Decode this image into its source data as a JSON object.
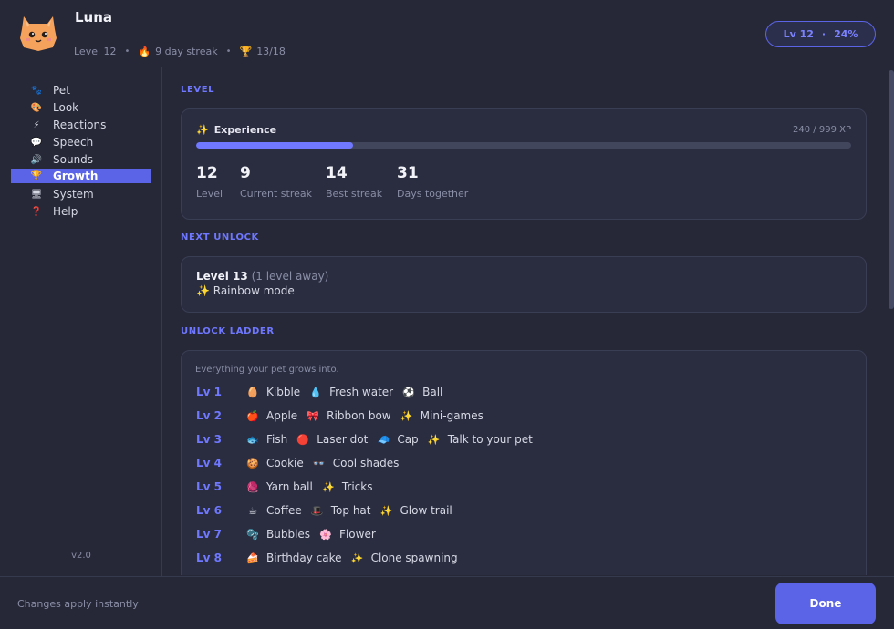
{
  "header": {
    "pet_name": "Luna",
    "level_text": "Level 12",
    "streak_icon": "🔥",
    "streak_text": "9 day streak",
    "trophy_icon": "🏆",
    "trophy_text": "13/18",
    "pill_level": "Lv 12",
    "pill_percent": "24%"
  },
  "sidebar": {
    "items": [
      {
        "icon": "🐾",
        "label": "Pet"
      },
      {
        "icon": "🎨",
        "label": "Look"
      },
      {
        "icon": "⚡",
        "label": "Reactions"
      },
      {
        "icon": "💬",
        "label": "Speech"
      },
      {
        "icon": "🔊",
        "label": "Sounds"
      },
      {
        "icon": "🏆",
        "label": "Growth"
      },
      {
        "icon": "🖥",
        "label": "System"
      },
      {
        "icon": "❓",
        "label": "Help"
      }
    ],
    "active_index": 5,
    "version": "v2.0"
  },
  "level_section": {
    "title": "LEVEL",
    "xp_icon": "✨",
    "xp_label": "Experience",
    "xp_value": "240 / 999 XP",
    "xp_fraction": 0.24,
    "stats": [
      {
        "value": "12",
        "label": "Level"
      },
      {
        "value": "9",
        "label": "Current streak"
      },
      {
        "value": "14",
        "label": "Best streak"
      },
      {
        "value": "31",
        "label": "Days together"
      }
    ]
  },
  "next_unlock": {
    "title": "NEXT UNLOCK",
    "level": "Level 13",
    "away": "(1 level away)",
    "reward": "✨ Rainbow mode"
  },
  "ladder": {
    "title": "UNLOCK LADDER",
    "caption": "Everything your pet grows into.",
    "rows": [
      {
        "lv": "Lv 1",
        "rewards": [
          {
            "icon": "🥚",
            "label": "Kibble"
          },
          {
            "icon": "💧",
            "label": "Fresh water"
          },
          {
            "icon": "⚽",
            "label": "Ball"
          }
        ]
      },
      {
        "lv": "Lv 2",
        "rewards": [
          {
            "icon": "🍎",
            "label": "Apple"
          },
          {
            "icon": "🎀",
            "label": "Ribbon bow"
          },
          {
            "icon": "✨",
            "label": "Mini-games"
          }
        ]
      },
      {
        "lv": "Lv 3",
        "rewards": [
          {
            "icon": "🐟",
            "label": "Fish"
          },
          {
            "icon": "🔴",
            "label": "Laser dot"
          },
          {
            "icon": "🧢",
            "label": "Cap"
          },
          {
            "icon": "✨",
            "label": "Talk to your pet"
          }
        ]
      },
      {
        "lv": "Lv 4",
        "rewards": [
          {
            "icon": "🍪",
            "label": "Cookie"
          },
          {
            "icon": "👓",
            "label": "Cool shades"
          }
        ]
      },
      {
        "lv": "Lv 5",
        "rewards": [
          {
            "icon": "🧶",
            "label": "Yarn ball"
          },
          {
            "icon": "✨",
            "label": "Tricks"
          }
        ]
      },
      {
        "lv": "Lv 6",
        "rewards": [
          {
            "icon": "☕",
            "label": "Coffee"
          },
          {
            "icon": "🎩",
            "label": "Top hat"
          },
          {
            "icon": "✨",
            "label": "Glow trail"
          }
        ]
      },
      {
        "lv": "Lv 7",
        "rewards": [
          {
            "icon": "🫧",
            "label": "Bubbles"
          },
          {
            "icon": "🌸",
            "label": "Flower"
          }
        ]
      },
      {
        "lv": "Lv 8",
        "rewards": [
          {
            "icon": "🍰",
            "label": "Birthday cake"
          },
          {
            "icon": "✨",
            "label": "Clone spawning"
          }
        ]
      }
    ]
  },
  "footer": {
    "note": "Changes apply instantly",
    "done_label": "Done"
  },
  "colors": {
    "accent": "#5b63e6",
    "accent_text": "#6f78ff",
    "background": "#262838",
    "card": "#2a2d40"
  }
}
